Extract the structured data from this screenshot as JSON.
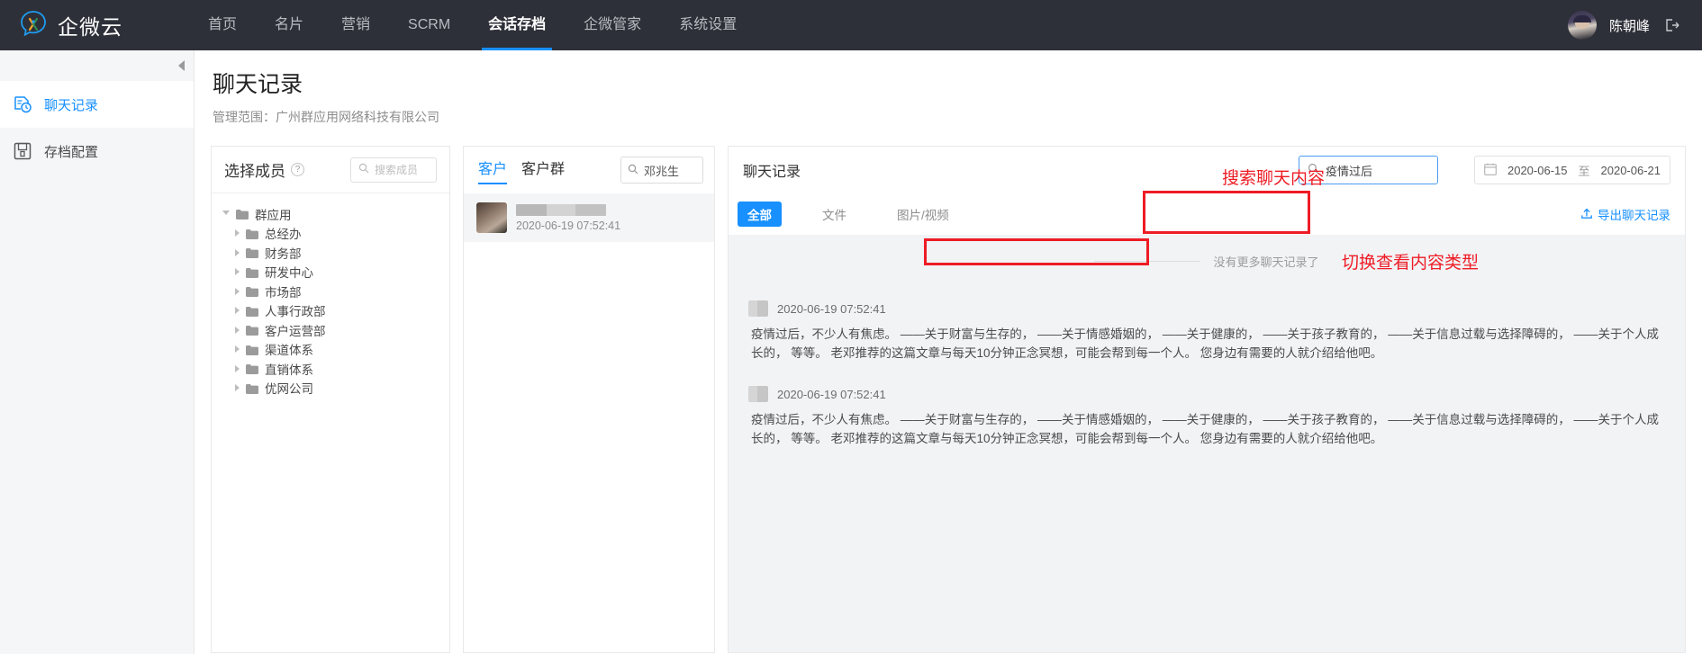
{
  "topnav": {
    "brand": "企微云",
    "items": [
      {
        "label": "首页",
        "active": false
      },
      {
        "label": "名片",
        "active": false
      },
      {
        "label": "营销",
        "active": false
      },
      {
        "label": "SCRM",
        "active": false
      },
      {
        "label": "会话存档",
        "active": true
      },
      {
        "label": "企微管家",
        "active": false
      },
      {
        "label": "系统设置",
        "active": false
      }
    ],
    "user_name": "陈朝峰",
    "logout_icon": "logout-icon",
    "avatar_icon": "user-avatar"
  },
  "sidebar": {
    "collapse_icon": "collapse-left-icon",
    "items": [
      {
        "label": "聊天记录",
        "icon": "chat-history-icon",
        "active": true
      },
      {
        "label": "存档配置",
        "icon": "floppy-disk-icon",
        "active": false
      }
    ]
  },
  "page": {
    "title": "聊天记录",
    "scope": "管理范围：广州群应用网络科技有限公司"
  },
  "members_panel": {
    "title": "选择成员",
    "help_icon": "question-mark-icon",
    "search_placeholder": "搜索成员",
    "search_icon": "search-icon",
    "tree": [
      {
        "label": "群应用",
        "level": 1,
        "expanded": true
      },
      {
        "label": "总经办",
        "level": 2,
        "expanded": false
      },
      {
        "label": "财务部",
        "level": 2,
        "expanded": false
      },
      {
        "label": "研发中心",
        "level": 2,
        "expanded": false
      },
      {
        "label": "市场部",
        "level": 2,
        "expanded": false
      },
      {
        "label": "人事行政部",
        "level": 2,
        "expanded": false
      },
      {
        "label": "客户运营部",
        "level": 2,
        "expanded": false
      },
      {
        "label": "渠道体系",
        "level": 2,
        "expanded": false
      },
      {
        "label": "直销体系",
        "level": 2,
        "expanded": false
      },
      {
        "label": "优网公司",
        "level": 2,
        "expanded": false
      }
    ]
  },
  "contacts_panel": {
    "tabs": [
      {
        "label": "客户",
        "active": true
      },
      {
        "label": "客户群",
        "active": false
      }
    ],
    "search_value": "邓兆生",
    "search_icon": "search-icon",
    "items": [
      {
        "name_masked": "",
        "time": "2020-06-19 07:52:41",
        "selected": true
      }
    ]
  },
  "chat_panel": {
    "title": "聊天记录",
    "search_value": "疫情过后",
    "search_icon": "search-icon",
    "calendar_icon": "calendar-icon",
    "date_start": "2020-06-15",
    "date_separator": "至",
    "date_end": "2020-06-21",
    "filters": [
      {
        "label": "全部",
        "active": true
      },
      {
        "label": "文件",
        "active": false
      },
      {
        "label": "图片/视频",
        "active": false
      }
    ],
    "export_label": "导出聊天记录",
    "export_icon": "upload-icon",
    "no_more_text": "没有更多聊天记录了",
    "messages": [
      {
        "time": "2020-06-19 07:52:41",
        "text": "疫情过后，不少人有焦虑。 ——关于财富与生存的， ——关于情感婚姻的， ——关于健康的， ——关于孩子教育的， ——关于信息过载与选择障碍的， ——关于个人成长的， 等等。 老邓推荐的这篇文章与每天10分钟正念冥想，可能会帮到每一个人。 您身边有需要的人就介绍给他吧。"
      },
      {
        "time": "2020-06-19 07:52:41",
        "text": "疫情过后，不少人有焦虑。 ——关于财富与生存的， ——关于情感婚姻的， ——关于健康的， ——关于孩子教育的， ——关于信息过载与选择障碍的， ——关于个人成长的， 等等。 老邓推荐的这篇文章与每天10分钟正念冥想，可能会帮到每一个人。 您身边有需要的人就介绍给他吧。"
      }
    ]
  },
  "annotations": {
    "search_content": "搜索聊天内容",
    "switch_type": "切换查看内容类型",
    "color": "#ee1c25"
  }
}
